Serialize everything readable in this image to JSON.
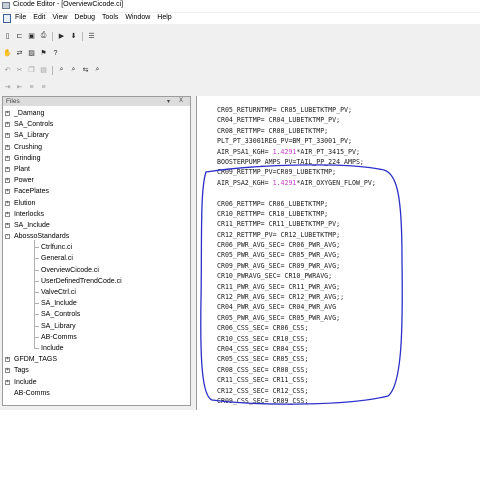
{
  "window": {
    "title": "Cicode Editor - [OverviewCicode.ci]"
  },
  "menu": [
    "File",
    "Edit",
    "View",
    "Debug",
    "Tools",
    "Window",
    "Help"
  ],
  "toolbar_icons": [
    [
      "new-file-icon",
      "open-folder-icon",
      "save-icon",
      "print-icon",
      "run-icon",
      "compile-icon",
      "list-icon"
    ],
    [
      "hand-icon",
      "toggle-icon",
      "image-icon",
      "bookmark-icon",
      "help-icon"
    ],
    [
      "undo-icon",
      "cut-icon",
      "copy-icon",
      "paste-icon",
      "find-icon",
      "find-next-icon",
      "replace-icon",
      "find-in-files-icon"
    ],
    [
      "indent-icon",
      "outdent-icon",
      "comment-icon",
      "uncomment-icon"
    ]
  ],
  "files_panel": {
    "label": "Files",
    "controls": [
      "▾",
      "X"
    ]
  },
  "tree": [
    {
      "label": "_Damang",
      "expander": "+",
      "level": 0
    },
    {
      "label": "SA_Controls",
      "expander": "+",
      "level": 0
    },
    {
      "label": "SA_Library",
      "expander": "+",
      "level": 0
    },
    {
      "label": "Crushing",
      "expander": "+",
      "level": 0
    },
    {
      "label": "Grinding",
      "expander": "+",
      "level": 0
    },
    {
      "label": "Plant",
      "expander": "+",
      "level": 0
    },
    {
      "label": "Power",
      "expander": "+",
      "level": 0
    },
    {
      "label": "FacePlates",
      "expander": "+",
      "level": 0
    },
    {
      "label": "Elution",
      "expander": "+",
      "level": 0
    },
    {
      "label": "Interlocks",
      "expander": "+",
      "level": 0
    },
    {
      "label": "SA_Include",
      "expander": "+",
      "level": 0
    },
    {
      "label": "AbossoStandards",
      "expander": "-",
      "level": 0
    },
    {
      "label": "Ctrlfunc.ci",
      "level": 1
    },
    {
      "label": "General.ci",
      "level": 1
    },
    {
      "label": "OverviewCicode.ci",
      "level": 1
    },
    {
      "label": "UserDefinedTrendCode.ci",
      "level": 1
    },
    {
      "label": "ValveCtrl.ci",
      "level": 1
    },
    {
      "label": "SA_Include",
      "level": 1
    },
    {
      "label": "SA_Controls",
      "level": 1
    },
    {
      "label": "SA_Library",
      "level": 1
    },
    {
      "label": "AB-Comms",
      "level": 1
    },
    {
      "label": "Include",
      "level": 1
    },
    {
      "label": "GFDM_TAGS",
      "expander": "+",
      "level": 0
    },
    {
      "label": "Tags",
      "expander": "+",
      "level": 0
    },
    {
      "label": "Include",
      "expander": "+",
      "level": 0
    },
    {
      "label": "AB-Comms",
      "level": 0
    }
  ],
  "code_lines": [
    [
      "CR05_RETURNTMP= CR05_LUBETKTMP_PV;"
    ],
    [
      "CR04_RETTMP= CR04_LUBETKTMP_PV;"
    ],
    [
      "CR08_RETTMP= CR08_LUBETKTMP;"
    ],
    [
      "PLT_PT_33001REG_PV=BM_PT_33001_PV;"
    ],
    [
      "AIR_PSA1_KGH= ",
      "1.4291",
      "*AIR_PT_3415_PV;"
    ],
    [
      "BOOSTERPUMP_AMPS_PV=TAIL_PP_224_AMPS;"
    ],
    [
      "CR09_RETTMP_PV=CR09_LUBETKTMP;"
    ],
    [
      "AIR_PSA2_KGH= ",
      "1.4291",
      "*AIR_OXYGEN_FLOW_PV;"
    ],
    [
      ""
    ],
    [
      "CR06_RETTMP= CR06_LUBETKTMP;"
    ],
    [
      "CR10_RETTMP= CR10_LUBETKTMP;"
    ],
    [
      "CR11_RETTMP= CR11_LUBETKTMP_PV;"
    ],
    [
      "CR12_RETTMP_PV= CR12_LUBETKTMP;"
    ],
    [
      "CR06_PWR_AVG_SEC= CR06_PWR_AVG;"
    ],
    [
      "CR05_PWR_AVG_SEC= CR05_PWR_AVG;"
    ],
    [
      "CR09_PWR_AVG_SEC= CR09_PWR_AVG;"
    ],
    [
      "CR10_PWRAVG_SEC= CR10_PWRAVG;"
    ],
    [
      "CR11_PWR_AVG_SEC= CR11_PWR_AVG;"
    ],
    [
      "CR12_PWR_AVG_SEC= CR12_PWR_AVG;;"
    ],
    [
      "CR04_PWR_AVG_SEC= CR04_PWR_AVG"
    ],
    [
      "CR05_PWR_AVG_SEC= CR05_PWR_AVG;"
    ],
    [
      "CR06_CSS_SEC= CR06_CSS;"
    ],
    [
      "CR10_CSS_SEC= CR10_CSS;"
    ],
    [
      "CR04_CSS_SEC= CR04_CSS;"
    ],
    [
      "CR05_CSS_SEC= CR05_CSS;"
    ],
    [
      "CR08_CSS_SEC= CR08_CSS;"
    ],
    [
      "CR11_CSS_SEC= CR11_CSS;"
    ],
    [
      "CR12_CSS_SEC= CR12_CSS;"
    ],
    [
      "CR09_CSS_SEC= CR09_CSS;"
    ]
  ],
  "colors": {
    "number": "#d13fd1",
    "annotation": "#2b2fc7"
  }
}
